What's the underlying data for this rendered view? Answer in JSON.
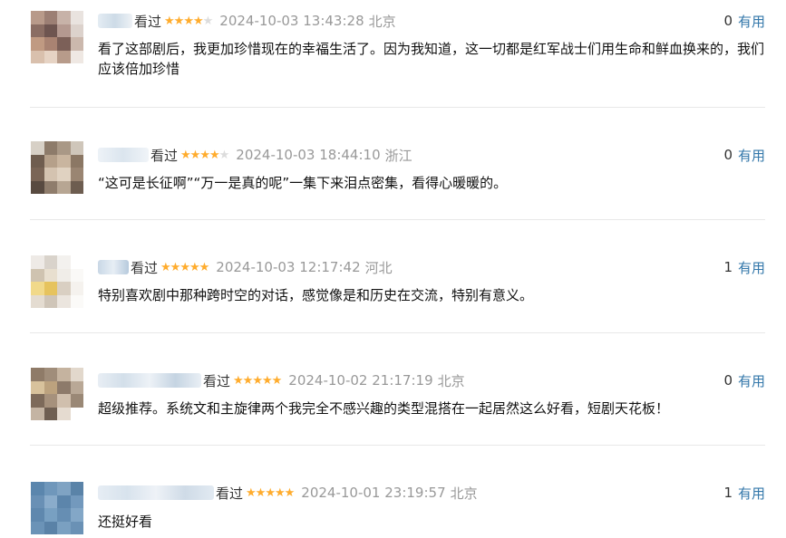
{
  "labels": {
    "seen": "看过",
    "useful": "有用"
  },
  "colors": {
    "star_filled": "#ffac2d",
    "star_empty": "#dcdcdc",
    "useful_link": "#3377aa",
    "meta_text": "#999999"
  },
  "comments": [
    {
      "rating": 4,
      "time": "2024-10-03 13:43:28",
      "location": "北京",
      "votes": "0",
      "content": "看了这部剧后，我更加珍惜现在的幸福生活了。因为我知道，这一切都是红军战士们用生命和鲜血换来的，我们应该倍加珍惜"
    },
    {
      "rating": 4,
      "time": "2024-10-03 18:44:10",
      "location": "浙江",
      "votes": "0",
      "content": "“这可是长征啊”“万一是真的呢”一集下来泪点密集，看得心暖暖的。"
    },
    {
      "rating": 5,
      "time": "2024-10-03 12:17:42",
      "location": "河北",
      "votes": "1",
      "content": "特别喜欢剧中那种跨时空的对话，感觉像是和历史在交流，特别有意义。"
    },
    {
      "rating": 5,
      "time": "2024-10-02 21:17:19",
      "location": "北京",
      "votes": "0",
      "content": "超级推荐。系统文和主旋律两个我完全不感兴趣的类型混搭在一起居然这么好看，短剧天花板！"
    },
    {
      "rating": 5,
      "time": "2024-10-01 23:19:57",
      "location": "北京",
      "votes": "1",
      "content": "还挺好看"
    }
  ]
}
